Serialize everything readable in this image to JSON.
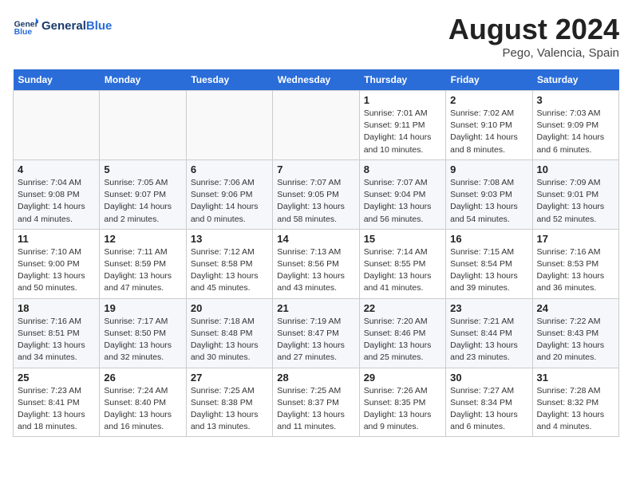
{
  "logo": {
    "text_general": "General",
    "text_blue": "Blue"
  },
  "title": {
    "month_year": "August 2024",
    "location": "Pego, Valencia, Spain"
  },
  "weekdays": [
    "Sunday",
    "Monday",
    "Tuesday",
    "Wednesday",
    "Thursday",
    "Friday",
    "Saturday"
  ],
  "weeks": [
    [
      {
        "day": "",
        "info": ""
      },
      {
        "day": "",
        "info": ""
      },
      {
        "day": "",
        "info": ""
      },
      {
        "day": "",
        "info": ""
      },
      {
        "day": "1",
        "info": "Sunrise: 7:01 AM\nSunset: 9:11 PM\nDaylight: 14 hours\nand 10 minutes."
      },
      {
        "day": "2",
        "info": "Sunrise: 7:02 AM\nSunset: 9:10 PM\nDaylight: 14 hours\nand 8 minutes."
      },
      {
        "day": "3",
        "info": "Sunrise: 7:03 AM\nSunset: 9:09 PM\nDaylight: 14 hours\nand 6 minutes."
      }
    ],
    [
      {
        "day": "4",
        "info": "Sunrise: 7:04 AM\nSunset: 9:08 PM\nDaylight: 14 hours\nand 4 minutes."
      },
      {
        "day": "5",
        "info": "Sunrise: 7:05 AM\nSunset: 9:07 PM\nDaylight: 14 hours\nand 2 minutes."
      },
      {
        "day": "6",
        "info": "Sunrise: 7:06 AM\nSunset: 9:06 PM\nDaylight: 14 hours\nand 0 minutes."
      },
      {
        "day": "7",
        "info": "Sunrise: 7:07 AM\nSunset: 9:05 PM\nDaylight: 13 hours\nand 58 minutes."
      },
      {
        "day": "8",
        "info": "Sunrise: 7:07 AM\nSunset: 9:04 PM\nDaylight: 13 hours\nand 56 minutes."
      },
      {
        "day": "9",
        "info": "Sunrise: 7:08 AM\nSunset: 9:03 PM\nDaylight: 13 hours\nand 54 minutes."
      },
      {
        "day": "10",
        "info": "Sunrise: 7:09 AM\nSunset: 9:01 PM\nDaylight: 13 hours\nand 52 minutes."
      }
    ],
    [
      {
        "day": "11",
        "info": "Sunrise: 7:10 AM\nSunset: 9:00 PM\nDaylight: 13 hours\nand 50 minutes."
      },
      {
        "day": "12",
        "info": "Sunrise: 7:11 AM\nSunset: 8:59 PM\nDaylight: 13 hours\nand 47 minutes."
      },
      {
        "day": "13",
        "info": "Sunrise: 7:12 AM\nSunset: 8:58 PM\nDaylight: 13 hours\nand 45 minutes."
      },
      {
        "day": "14",
        "info": "Sunrise: 7:13 AM\nSunset: 8:56 PM\nDaylight: 13 hours\nand 43 minutes."
      },
      {
        "day": "15",
        "info": "Sunrise: 7:14 AM\nSunset: 8:55 PM\nDaylight: 13 hours\nand 41 minutes."
      },
      {
        "day": "16",
        "info": "Sunrise: 7:15 AM\nSunset: 8:54 PM\nDaylight: 13 hours\nand 39 minutes."
      },
      {
        "day": "17",
        "info": "Sunrise: 7:16 AM\nSunset: 8:53 PM\nDaylight: 13 hours\nand 36 minutes."
      }
    ],
    [
      {
        "day": "18",
        "info": "Sunrise: 7:16 AM\nSunset: 8:51 PM\nDaylight: 13 hours\nand 34 minutes."
      },
      {
        "day": "19",
        "info": "Sunrise: 7:17 AM\nSunset: 8:50 PM\nDaylight: 13 hours\nand 32 minutes."
      },
      {
        "day": "20",
        "info": "Sunrise: 7:18 AM\nSunset: 8:48 PM\nDaylight: 13 hours\nand 30 minutes."
      },
      {
        "day": "21",
        "info": "Sunrise: 7:19 AM\nSunset: 8:47 PM\nDaylight: 13 hours\nand 27 minutes."
      },
      {
        "day": "22",
        "info": "Sunrise: 7:20 AM\nSunset: 8:46 PM\nDaylight: 13 hours\nand 25 minutes."
      },
      {
        "day": "23",
        "info": "Sunrise: 7:21 AM\nSunset: 8:44 PM\nDaylight: 13 hours\nand 23 minutes."
      },
      {
        "day": "24",
        "info": "Sunrise: 7:22 AM\nSunset: 8:43 PM\nDaylight: 13 hours\nand 20 minutes."
      }
    ],
    [
      {
        "day": "25",
        "info": "Sunrise: 7:23 AM\nSunset: 8:41 PM\nDaylight: 13 hours\nand 18 minutes."
      },
      {
        "day": "26",
        "info": "Sunrise: 7:24 AM\nSunset: 8:40 PM\nDaylight: 13 hours\nand 16 minutes."
      },
      {
        "day": "27",
        "info": "Sunrise: 7:25 AM\nSunset: 8:38 PM\nDaylight: 13 hours\nand 13 minutes."
      },
      {
        "day": "28",
        "info": "Sunrise: 7:25 AM\nSunset: 8:37 PM\nDaylight: 13 hours\nand 11 minutes."
      },
      {
        "day": "29",
        "info": "Sunrise: 7:26 AM\nSunset: 8:35 PM\nDaylight: 13 hours\nand 9 minutes."
      },
      {
        "day": "30",
        "info": "Sunrise: 7:27 AM\nSunset: 8:34 PM\nDaylight: 13 hours\nand 6 minutes."
      },
      {
        "day": "31",
        "info": "Sunrise: 7:28 AM\nSunset: 8:32 PM\nDaylight: 13 hours\nand 4 minutes."
      }
    ]
  ]
}
